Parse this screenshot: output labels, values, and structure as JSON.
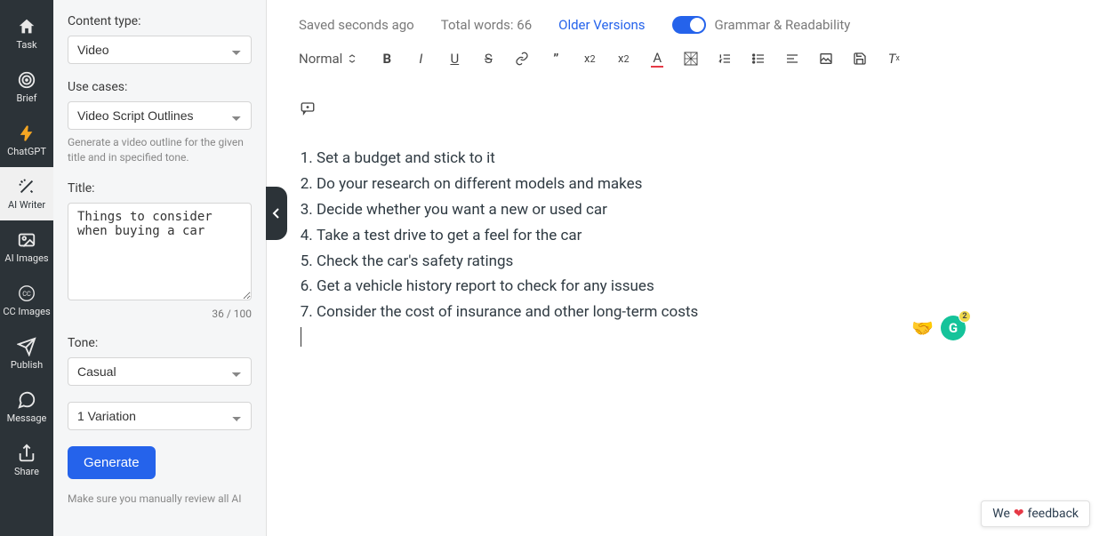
{
  "rail": [
    {
      "label": "Task",
      "icon": "home"
    },
    {
      "label": "Brief",
      "icon": "target"
    },
    {
      "label": "ChatGPT",
      "icon": "chat"
    },
    {
      "label": "AI Writer",
      "icon": "wand",
      "active": true
    },
    {
      "label": "AI Images",
      "icon": "image"
    },
    {
      "label": "CC Images",
      "icon": "cc"
    },
    {
      "label": "Publish",
      "icon": "send"
    },
    {
      "label": "Message",
      "icon": "message"
    },
    {
      "label": "Share",
      "icon": "share"
    }
  ],
  "settings": {
    "content_type_label": "Content type:",
    "content_type_value": "Video",
    "use_cases_label": "Use cases:",
    "use_cases_value": "Video Script Outlines",
    "use_cases_desc": "Generate a video outline for the given title and in specified tone.",
    "title_label": "Title:",
    "title_value": "Things to consider when buying a car",
    "title_counter": "36 / 100",
    "tone_label": "Tone:",
    "tone_value": "Casual",
    "variation_value": "1 Variation",
    "generate_label": "Generate",
    "footnote": "Make sure you manually review all AI"
  },
  "topbar": {
    "saved": "Saved seconds ago",
    "total_words": "Total words: 66",
    "older_versions": "Older Versions",
    "grammar": "Grammar & Readability"
  },
  "toolbar": {
    "format": "Normal"
  },
  "content_items": [
    "Set a budget and stick to it",
    "Do your research on different models and makes",
    "Decide whether you want a new or used car",
    "Take a test drive to get a feel for the car",
    "Check the car's safety ratings",
    "Get a vehicle history report to check for any issues",
    "Consider the cost of insurance and other long-term costs"
  ],
  "grammarly": {
    "count": "2"
  },
  "feedback": {
    "prefix": "We",
    "suffix": "feedback"
  }
}
